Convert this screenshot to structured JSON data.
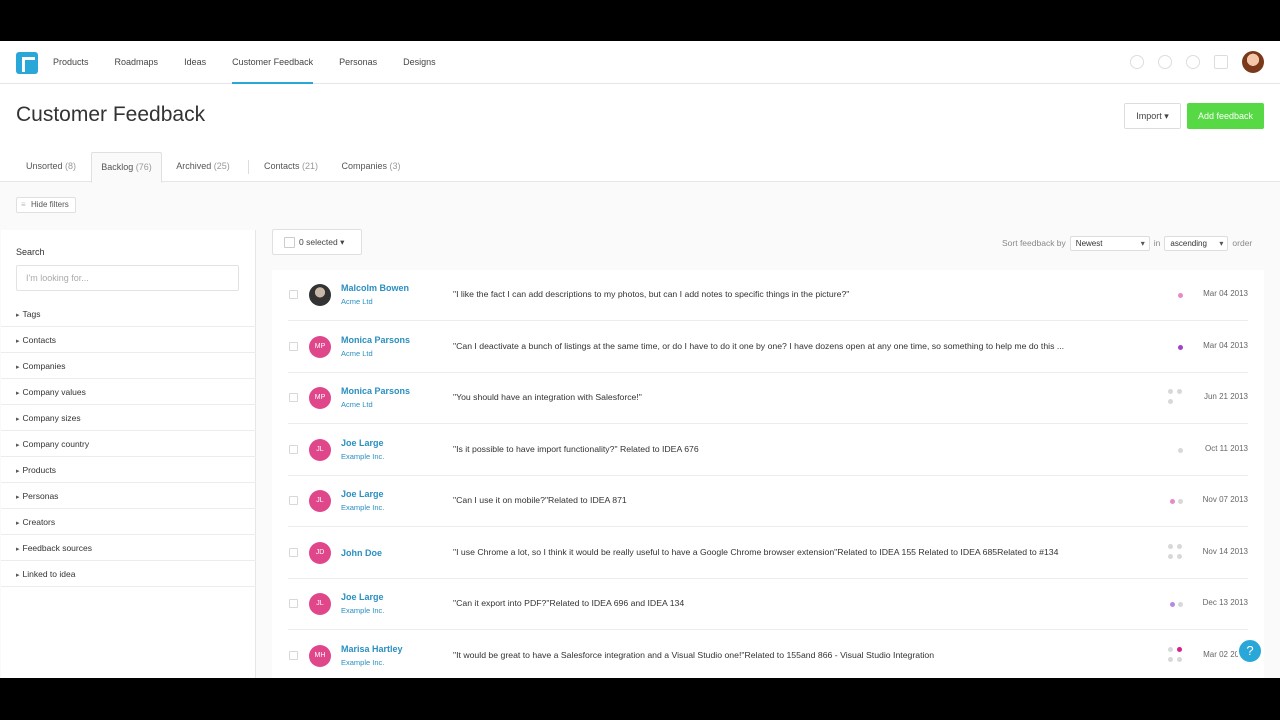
{
  "nav": {
    "items": [
      "Products",
      "Roadmaps",
      "Ideas",
      "Customer Feedback",
      "Personas",
      "Designs"
    ],
    "active": "Customer Feedback"
  },
  "header": {
    "title": "Customer Feedback",
    "import_label": "Import ▾",
    "add_label": "Add feedback"
  },
  "tabs": [
    {
      "label": "Unsorted",
      "count": "(8)"
    },
    {
      "label": "Backlog",
      "count": "(76)"
    },
    {
      "label": "Archived",
      "count": "(25)"
    },
    {
      "label": "Contacts",
      "count": "(21)"
    },
    {
      "label": "Companies",
      "count": "(3)"
    }
  ],
  "hide_filters_label": "Hide filters",
  "sidebar": {
    "search_label": "Search",
    "search_placeholder": "I'm looking for...",
    "filters": [
      "Tags",
      "Contacts",
      "Companies",
      "Company values",
      "Company sizes",
      "Company country",
      "Products",
      "Personas",
      "Creators",
      "Feedback sources",
      "Linked to idea"
    ]
  },
  "toolbar": {
    "selected_label": "0 selected ▾",
    "sort_prefix": "Sort feedback by",
    "sort_value": "Newest",
    "in_label": "in",
    "order_value": "ascending",
    "order_suffix": "order"
  },
  "feedback": [
    {
      "name": "Malcolm Bowen",
      "company": "Acme Ltd",
      "initials": "",
      "text": "\"I like the fact I can add descriptions to my photos, but can I add notes to specific things in the picture?\"",
      "date": "Mar 04 2013",
      "dots": [
        "#e889c9"
      ]
    },
    {
      "name": "Monica Parsons",
      "company": "Acme Ltd",
      "initials": "MP",
      "text": "\"Can I deactivate a bunch of listings at the same time, or do I have to do it one by one? I have dozens open at any one time, so something to help me do this ...",
      "date": "Mar 04 2013",
      "dots": [
        "#a143c8"
      ]
    },
    {
      "name": "Monica Parsons",
      "company": "Acme Ltd",
      "initials": "MP",
      "text": "\"You should have an integration with Salesforce!\"",
      "date": "Jun 21 2013",
      "dots": [
        "#d8d8d8",
        "#d8d8d8",
        "#d8d8d8"
      ]
    },
    {
      "name": "Joe Large",
      "company": "Example Inc.",
      "initials": "JL",
      "text": "\"Is it possible to have import functionality?\" Related to IDEA 676",
      "date": "Oct 11 2013",
      "dots": [
        "#d8d8d8"
      ]
    },
    {
      "name": "Joe Large",
      "company": "Example Inc.",
      "initials": "JL",
      "text": "\"Can I use it on mobile?\"Related to IDEA 871",
      "date": "Nov 07 2013",
      "dots": [
        "#e889c9",
        "#d8d8d8"
      ]
    },
    {
      "name": "John Doe",
      "company": "",
      "initials": "JD",
      "text": "\"I use Chrome a lot, so I think it would be really useful to have a Google Chrome browser extension\"Related to IDEA 155 Related to IDEA 685Related to #134",
      "date": "Nov 14 2013",
      "dots": [
        "#d8d8d8",
        "#d8d8d8",
        "#d8d8d8",
        "#d8d8d8"
      ]
    },
    {
      "name": "Joe Large",
      "company": "Example Inc.",
      "initials": "JL",
      "text": "\"Can it export into PDF?\"Related to IDEA 696 and IDEA 134",
      "date": "Dec 13 2013",
      "dots": [
        "#b58be0",
        "#d8d8d8"
      ]
    },
    {
      "name": "Marisa Hartley",
      "company": "Example Inc.",
      "initials": "MH",
      "text": "\"It would be great to have a Salesforce integration and a Visual Studio one!\"Related to 155and 866 - Visual Studio Integration",
      "date": "Mar 02 2014",
      "dots": [
        "#d8d8d8",
        "#d81e8a",
        "#d8d8d8",
        "#d8d8d8"
      ]
    }
  ],
  "help_icon": "?"
}
